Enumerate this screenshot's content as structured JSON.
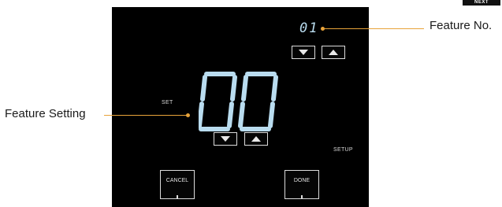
{
  "badge": {
    "label": "NEXT"
  },
  "display": {
    "feature_number": "01",
    "feature_setting": "00",
    "set_label": "SET",
    "setup_label": "SETUP"
  },
  "buttons": {
    "cancel_label": "CANCEL",
    "done_label": "DONE"
  },
  "callouts": {
    "feature_no": "Feature No.",
    "feature_setting": "Feature Setting"
  },
  "colors": {
    "screen_background": "#000000",
    "segment_digit": "#b9dcef",
    "callout_line": "#e8a33a"
  },
  "icons": [
    "triangle-down-icon",
    "triangle-up-icon"
  ]
}
